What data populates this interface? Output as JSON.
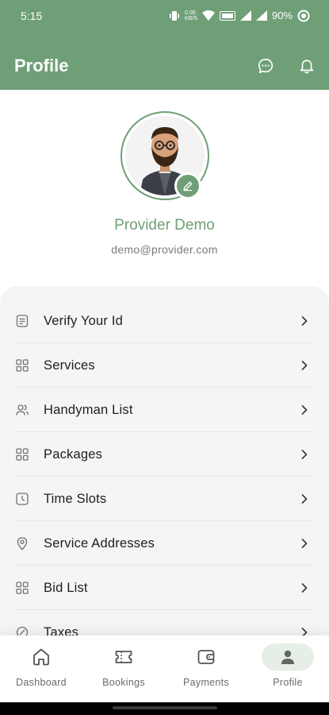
{
  "status_bar": {
    "time": "5:15",
    "net_speed_top": "0.00",
    "net_speed_bottom": "KB/S",
    "battery": "90%"
  },
  "app_bar": {
    "title": "Profile",
    "icons": [
      "chat-icon",
      "bell-icon"
    ],
    "color": "#6f9f77"
  },
  "profile": {
    "name": "Provider Demo",
    "email": "demo@provider.com"
  },
  "menu": {
    "items": [
      {
        "label": "Verify Your Id",
        "icon": "id-card-icon"
      },
      {
        "label": "Services",
        "icon": "grid-icon"
      },
      {
        "label": "Handyman List",
        "icon": "users-icon"
      },
      {
        "label": "Packages",
        "icon": "grid-icon"
      },
      {
        "label": "Time Slots",
        "icon": "clock-icon"
      },
      {
        "label": "Service Addresses",
        "icon": "location-pin-icon"
      },
      {
        "label": "Bid List",
        "icon": "grid-icon"
      },
      {
        "label": "Taxes",
        "icon": "tax-icon"
      }
    ]
  },
  "bottom_nav": {
    "items": [
      {
        "label": "Dashboard",
        "icon": "home-icon"
      },
      {
        "label": "Bookings",
        "icon": "ticket-icon"
      },
      {
        "label": "Payments",
        "icon": "wallet-icon"
      },
      {
        "label": "Profile",
        "icon": "person-icon",
        "active": true
      }
    ],
    "active_bg": "#e6efe7"
  }
}
